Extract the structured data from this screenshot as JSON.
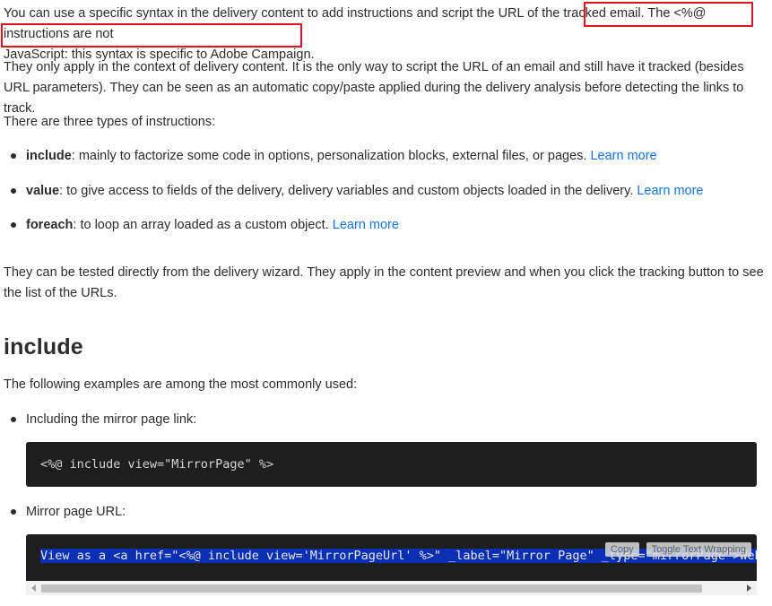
{
  "intro": {
    "part1": "You can use a specific syntax in the delivery content to add instructions and script the URL of the tracked email. ",
    "highlight_line1": "The <%@ instructions are not",
    "highlight_line2": "JavaScript: this syntax is specific to Adobe Campaign."
  },
  "para2": "They only apply in the context of delivery content. It is the only way to script the URL of an email and still have it tracked (besides URL parameters). They can be seen as an automatic copy/paste applied during the delivery analysis before detecting the links to track.",
  "para3": "There are three types of instructions:",
  "instructions": [
    {
      "term": "include",
      "desc": ": mainly to factorize some code in options, personalization blocks, external files, or pages. ",
      "link": "Learn more"
    },
    {
      "term": "value",
      "desc": ": to give access to fields of the delivery, delivery variables and custom objects loaded in the delivery. ",
      "link": "Learn more"
    },
    {
      "term": "foreach",
      "desc": ": to loop an array loaded as a custom object. ",
      "link": "Learn more"
    }
  ],
  "para4": "They can be tested directly from the delivery wizard. They apply in the content preview and when you click the tracking button to see the list of the URLs.",
  "section": {
    "heading": "include",
    "intro": "The following examples are among the most commonly used:",
    "examples": [
      {
        "label": "Including the mirror page link:",
        "code": "<%@ include view=\"MirrorPage\" %>"
      },
      {
        "label": "Mirror page URL:",
        "code": "View as a <a href=\"<%@ include view='MirrorPageUrl' %>\" _label=\"Mirror Page\" _type=\"mirrorPage\">Web page"
      }
    ]
  },
  "code_tools": {
    "copy": "Copy",
    "wrap": "Toggle Text Wrapping"
  },
  "colors": {
    "link": "#1473e6",
    "highlight_border": "#e0141e",
    "code_bg": "#1e1e1e",
    "selection": "#0b2fb3"
  }
}
